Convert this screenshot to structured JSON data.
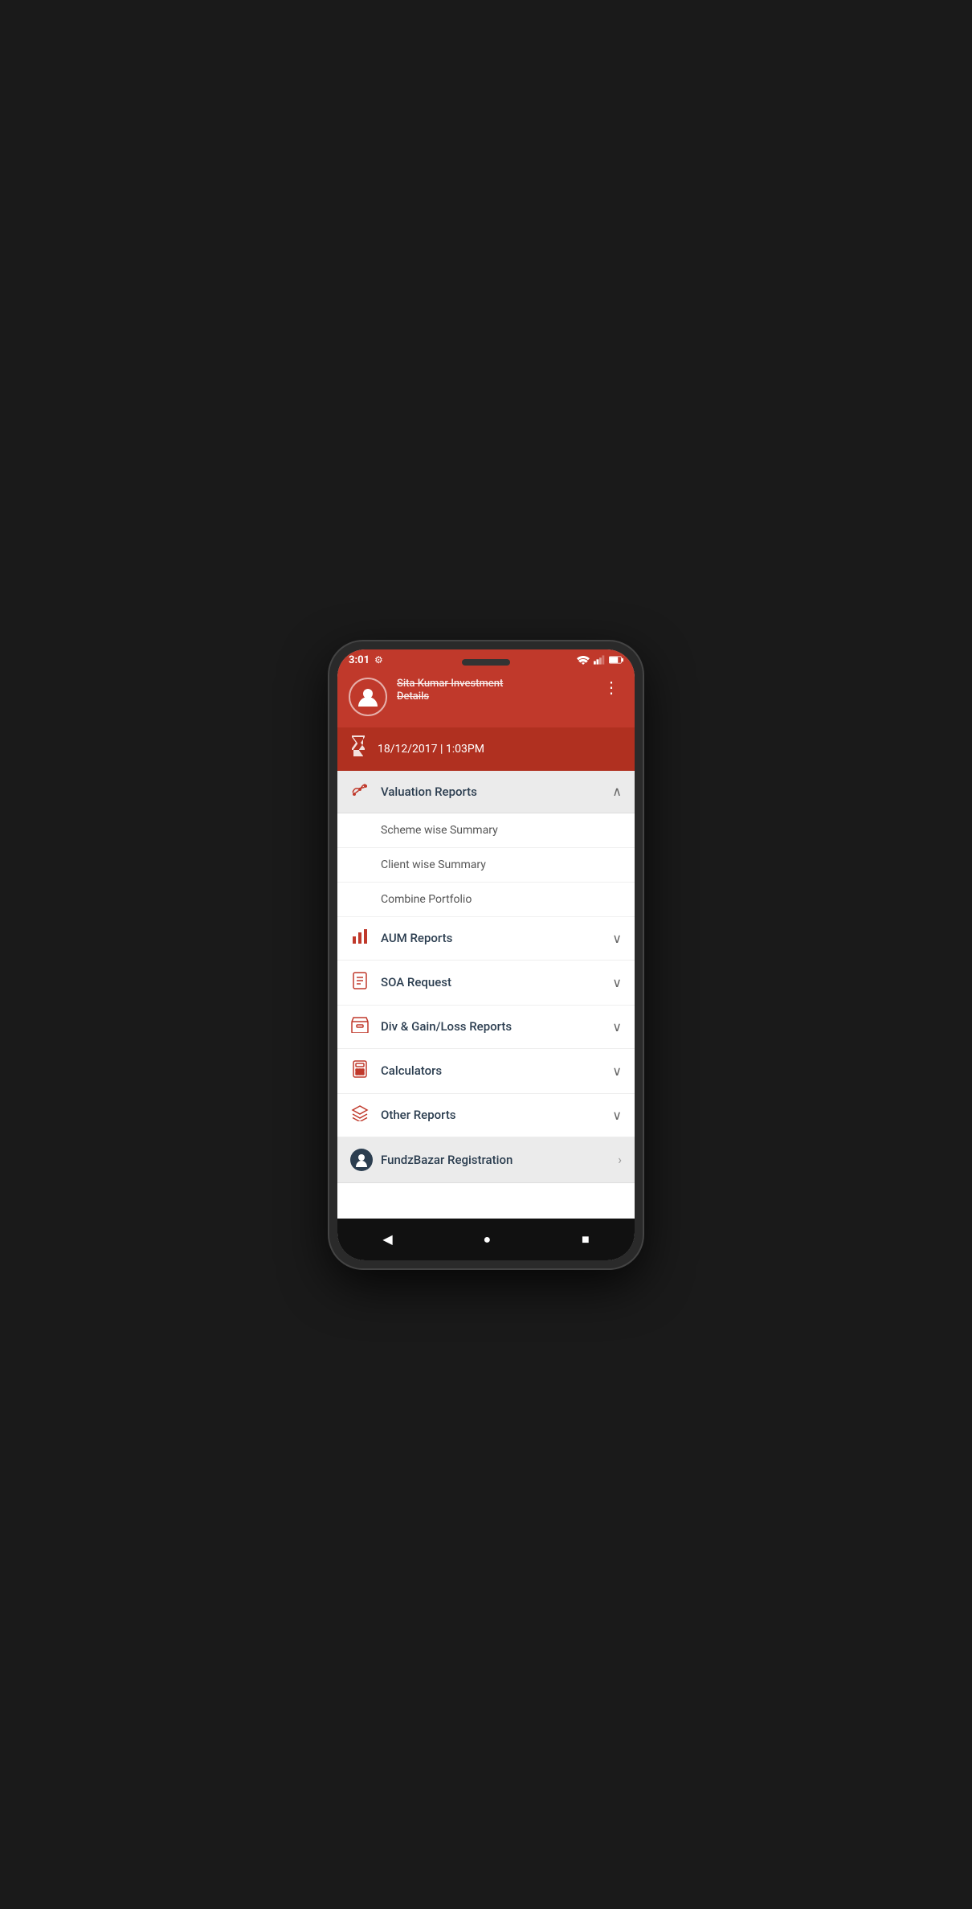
{
  "status": {
    "time": "3:01",
    "settings_icon": "gear-icon"
  },
  "header": {
    "name_line1": "Sita Kumar Investment",
    "name_line2": "Details",
    "more_icon": "more-vertical-icon"
  },
  "date_bar": {
    "icon": "hourglass-icon",
    "date_text": "18/12/2017 | 1:03PM"
  },
  "menu": {
    "sections": [
      {
        "id": "valuation",
        "label": "Valuation Reports",
        "icon": "graph-icon",
        "expanded": true,
        "sub_items": [
          {
            "label": "Scheme wise Summary"
          },
          {
            "label": "Client wise Summary"
          },
          {
            "label": "Combine Portfolio"
          }
        ]
      },
      {
        "id": "aum",
        "label": "AUM Reports",
        "icon": "bar-chart-icon",
        "expanded": false,
        "sub_items": []
      },
      {
        "id": "soa",
        "label": "SOA Request",
        "icon": "document-icon",
        "expanded": false,
        "sub_items": []
      },
      {
        "id": "divgain",
        "label": "Div & Gain/Loss Reports",
        "icon": "archive-icon",
        "expanded": false,
        "sub_items": []
      },
      {
        "id": "calculators",
        "label": "Calculators",
        "icon": "calculator-icon",
        "expanded": false,
        "sub_items": []
      },
      {
        "id": "other",
        "label": "Other Reports",
        "icon": "layers-icon",
        "expanded": false,
        "sub_items": []
      },
      {
        "id": "fundzbazar",
        "label": "FundzBazar Registration",
        "icon": "fundz-icon",
        "expanded": false,
        "sub_items": [],
        "arrow_right": true
      }
    ]
  },
  "bottom_nav": {
    "back": "◀",
    "home": "●",
    "recent": "■"
  }
}
